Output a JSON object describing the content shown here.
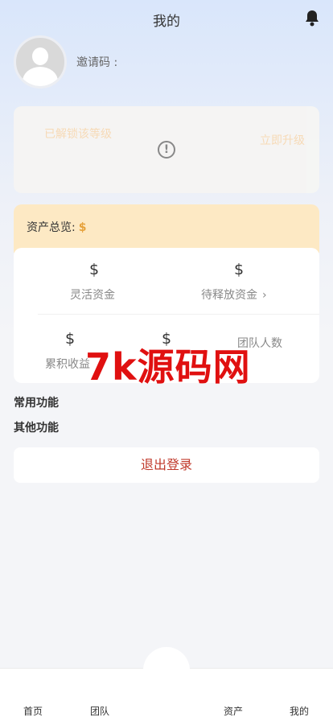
{
  "header": {
    "title": "我的",
    "bell_icon": "bell-icon"
  },
  "profile": {
    "avatar_icon": "user-avatar-icon",
    "invite_label": "邀请码 :"
  },
  "level": {
    "left_text": "已解锁该等级",
    "right_text": "立即升级",
    "alert_icon": "!"
  },
  "assets": {
    "label": "资产总览:",
    "dollar": "$"
  },
  "stats": [
    {
      "value": "$",
      "label": "灵活资金"
    },
    {
      "value": "$",
      "label": "待释放资金",
      "chevron": "›"
    },
    {
      "value": "$",
      "label": "累积收益"
    },
    {
      "value": "$",
      "label": ""
    },
    {
      "value": "",
      "label": "团队人数"
    }
  ],
  "watermark": "7k源码网",
  "sections": {
    "common": "常用功能",
    "other": "其他功能"
  },
  "logout": "退出登录",
  "tabs": [
    "首页",
    "团队",
    "",
    "资产",
    "我的"
  ],
  "colors": {
    "accent_red": "#c0392b",
    "assets_bg": "#fde9c4",
    "dollar": "#e6a23c"
  }
}
